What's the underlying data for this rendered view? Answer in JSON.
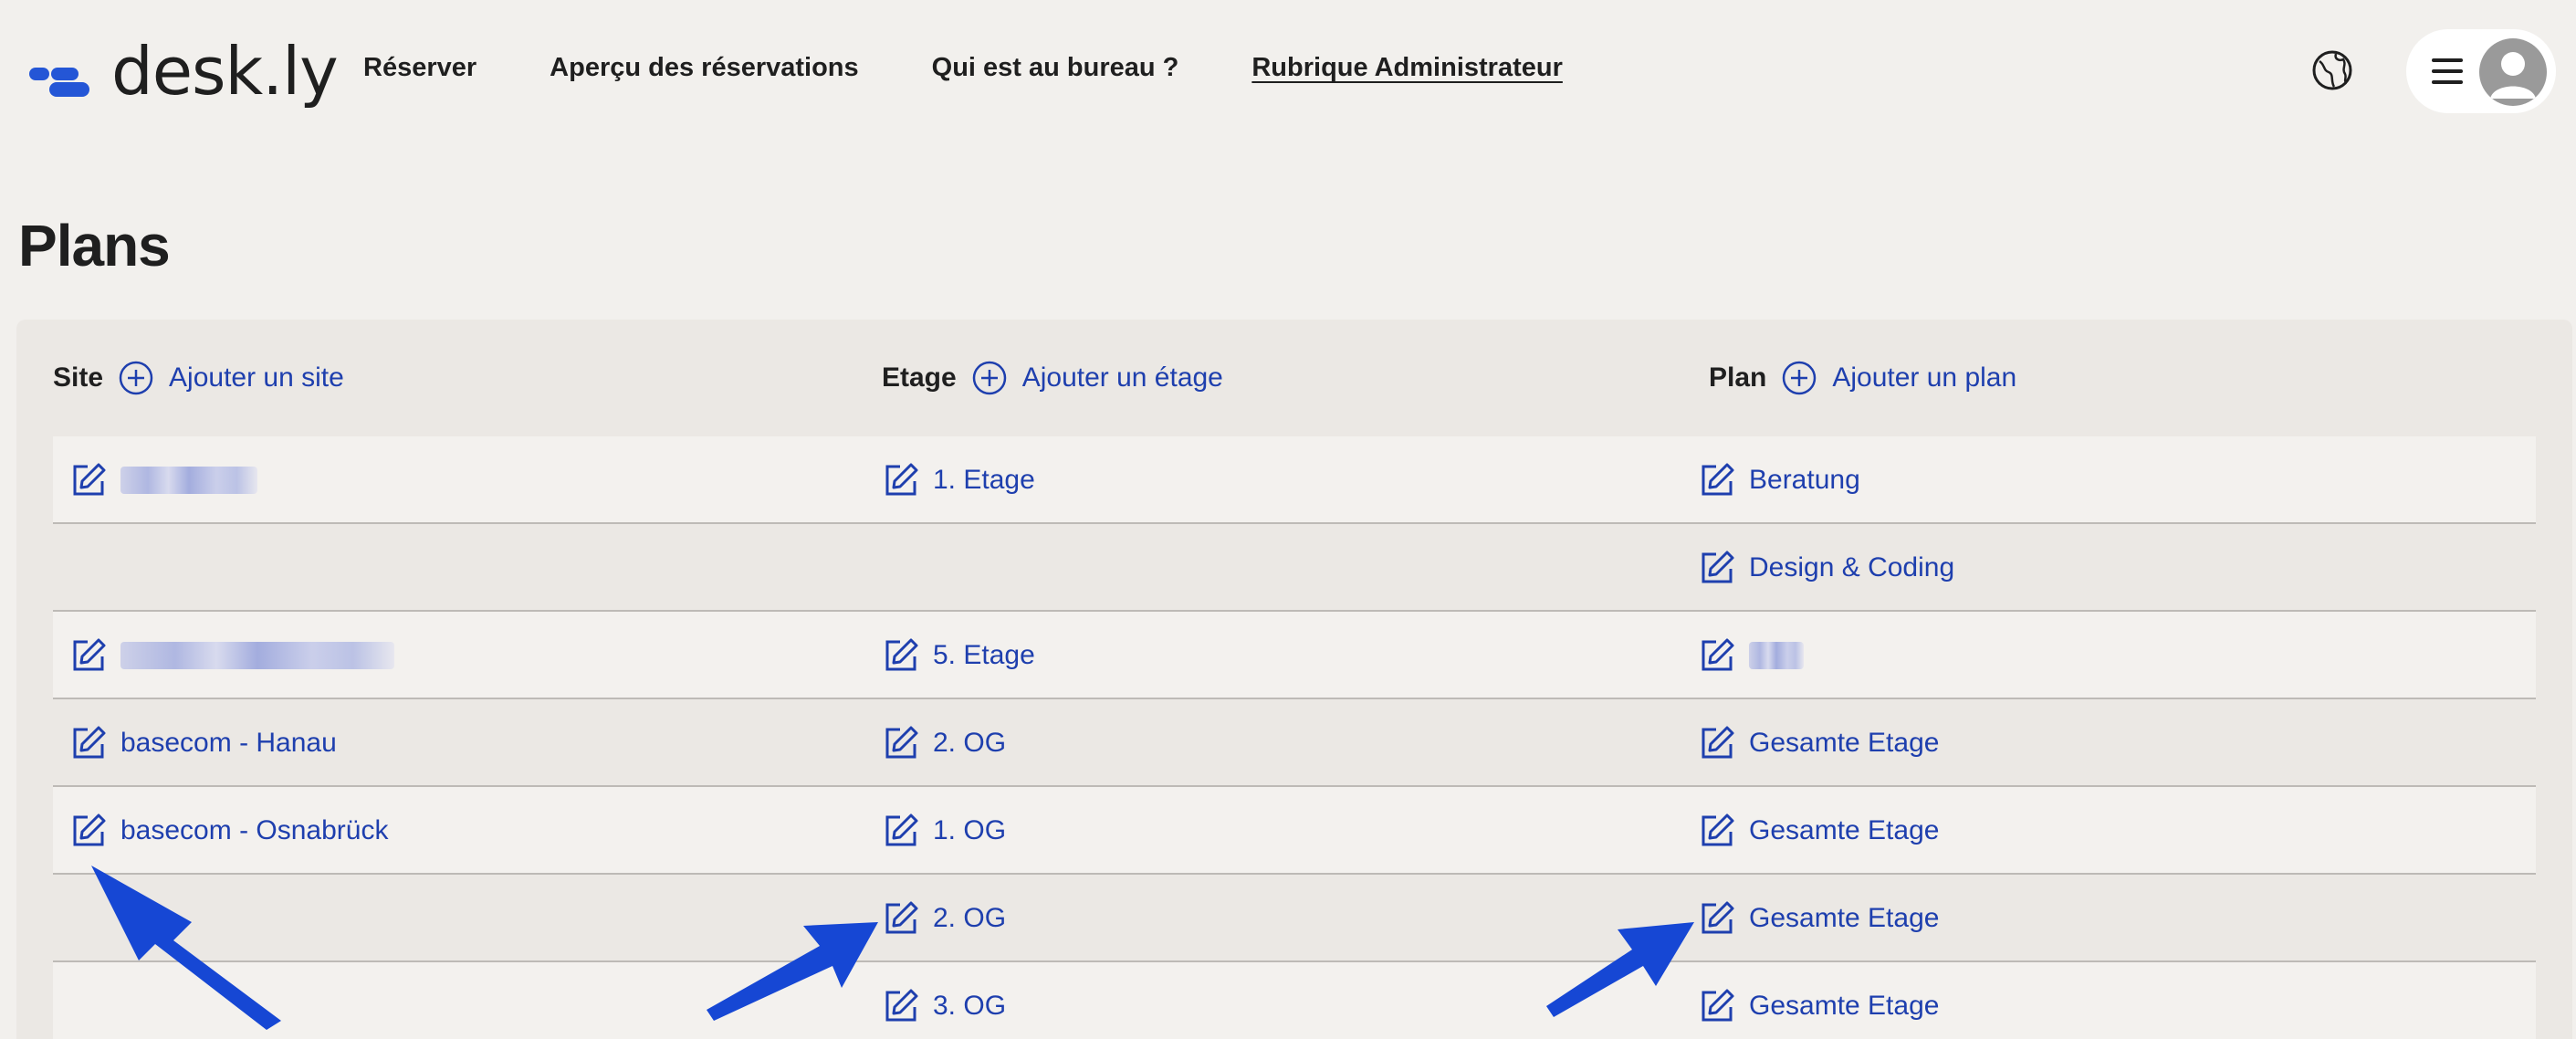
{
  "brand": {
    "name": "desk.ly",
    "accent": "#2456d6",
    "link_color": "#1e3fae"
  },
  "nav": {
    "items": [
      {
        "label": "Réserver"
      },
      {
        "label": "Aperçu des réservations"
      },
      {
        "label": "Qui est au bureau ?"
      },
      {
        "label": "Rubrique Administrateur"
      }
    ],
    "active_index": 3
  },
  "header_icons": [
    "globe-icon",
    "hamburger-menu-icon",
    "user-avatar-icon"
  ],
  "page": {
    "title": "Plans"
  },
  "columns": {
    "site": {
      "label": "Site",
      "add_label": "Ajouter un site"
    },
    "floor": {
      "label": "Etage",
      "add_label": "Ajouter un étage"
    },
    "plan": {
      "label": "Plan",
      "add_label": "Ajouter un plan"
    }
  },
  "rows": [
    {
      "site": "",
      "site_redacted": true,
      "floor": "1. Etage",
      "plan": "Beratung"
    },
    {
      "site": null,
      "floor": null,
      "plan": "Design & Coding"
    },
    {
      "site": "",
      "site_redacted": true,
      "floor": "5. Etage",
      "plan": "",
      "plan_redacted": true
    },
    {
      "site": "basecom - Hanau",
      "floor": "2. OG",
      "plan": "Gesamte Etage"
    },
    {
      "site": "basecom - Osnabrück",
      "floor": "1. OG",
      "plan": "Gesamte Etage"
    },
    {
      "site": null,
      "floor": "2. OG",
      "plan": "Gesamte Etage"
    },
    {
      "site": null,
      "floor": "3. OG",
      "plan": "Gesamte Etage"
    }
  ],
  "annotation_arrow_color": "#1647d4"
}
